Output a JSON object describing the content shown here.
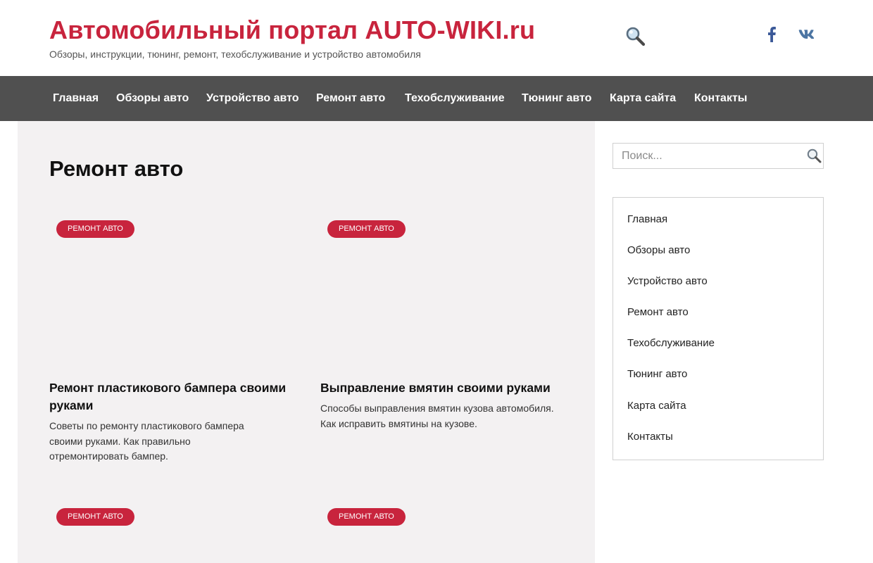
{
  "header": {
    "site_title": "Автомобильный портал AUTO-WIKI.ru",
    "site_description": "Обзоры, инструкции, тюнинг, ремонт, техобслуживание и устройство автомобиля",
    "search_icon": "search-icon",
    "social": [
      {
        "icon": "facebook-icon"
      },
      {
        "icon": "vk-icon"
      }
    ]
  },
  "nav": {
    "items": [
      {
        "label": "Главная"
      },
      {
        "label": "Обзоры авто"
      },
      {
        "label": "Устройство авто"
      },
      {
        "label": "Ремонт авто"
      },
      {
        "label": "Техобслуживание"
      },
      {
        "label": "Тюнинг авто"
      },
      {
        "label": "Карта сайта"
      },
      {
        "label": "Контакты"
      }
    ]
  },
  "main": {
    "page_title": "Ремонт авто",
    "posts": [
      {
        "category": "РЕМОНТ АВТО",
        "title": "Ремонт пластикового бампера своими руками",
        "excerpt": "Советы по ремонту пластикового бампера своими руками. Как правильно отремонтировать бампер."
      },
      {
        "category": "РЕМОНТ АВТО",
        "title": "Выправление вмятин своими руками",
        "excerpt": "Способы выправления вмятин кузова автомобиля. Как исправить вмятины на кузове."
      },
      {
        "category": "РЕМОНТ АВТО"
      },
      {
        "category": "РЕМОНТ АВТО"
      }
    ]
  },
  "sidebar": {
    "search_placeholder": "Поиск...",
    "menu": [
      {
        "label": "Главная"
      },
      {
        "label": "Обзоры авто"
      },
      {
        "label": "Устройство авто"
      },
      {
        "label": "Ремонт авто"
      },
      {
        "label": "Техобслуживание"
      },
      {
        "label": "Тюнинг авто"
      },
      {
        "label": "Карта сайта"
      },
      {
        "label": "Контакты"
      }
    ]
  },
  "colors": {
    "accent": "#c8243d",
    "nav_background": "#505050",
    "content_background": "#f3f1f2",
    "facebook": "#3b5998",
    "vk": "#4c75a3"
  }
}
